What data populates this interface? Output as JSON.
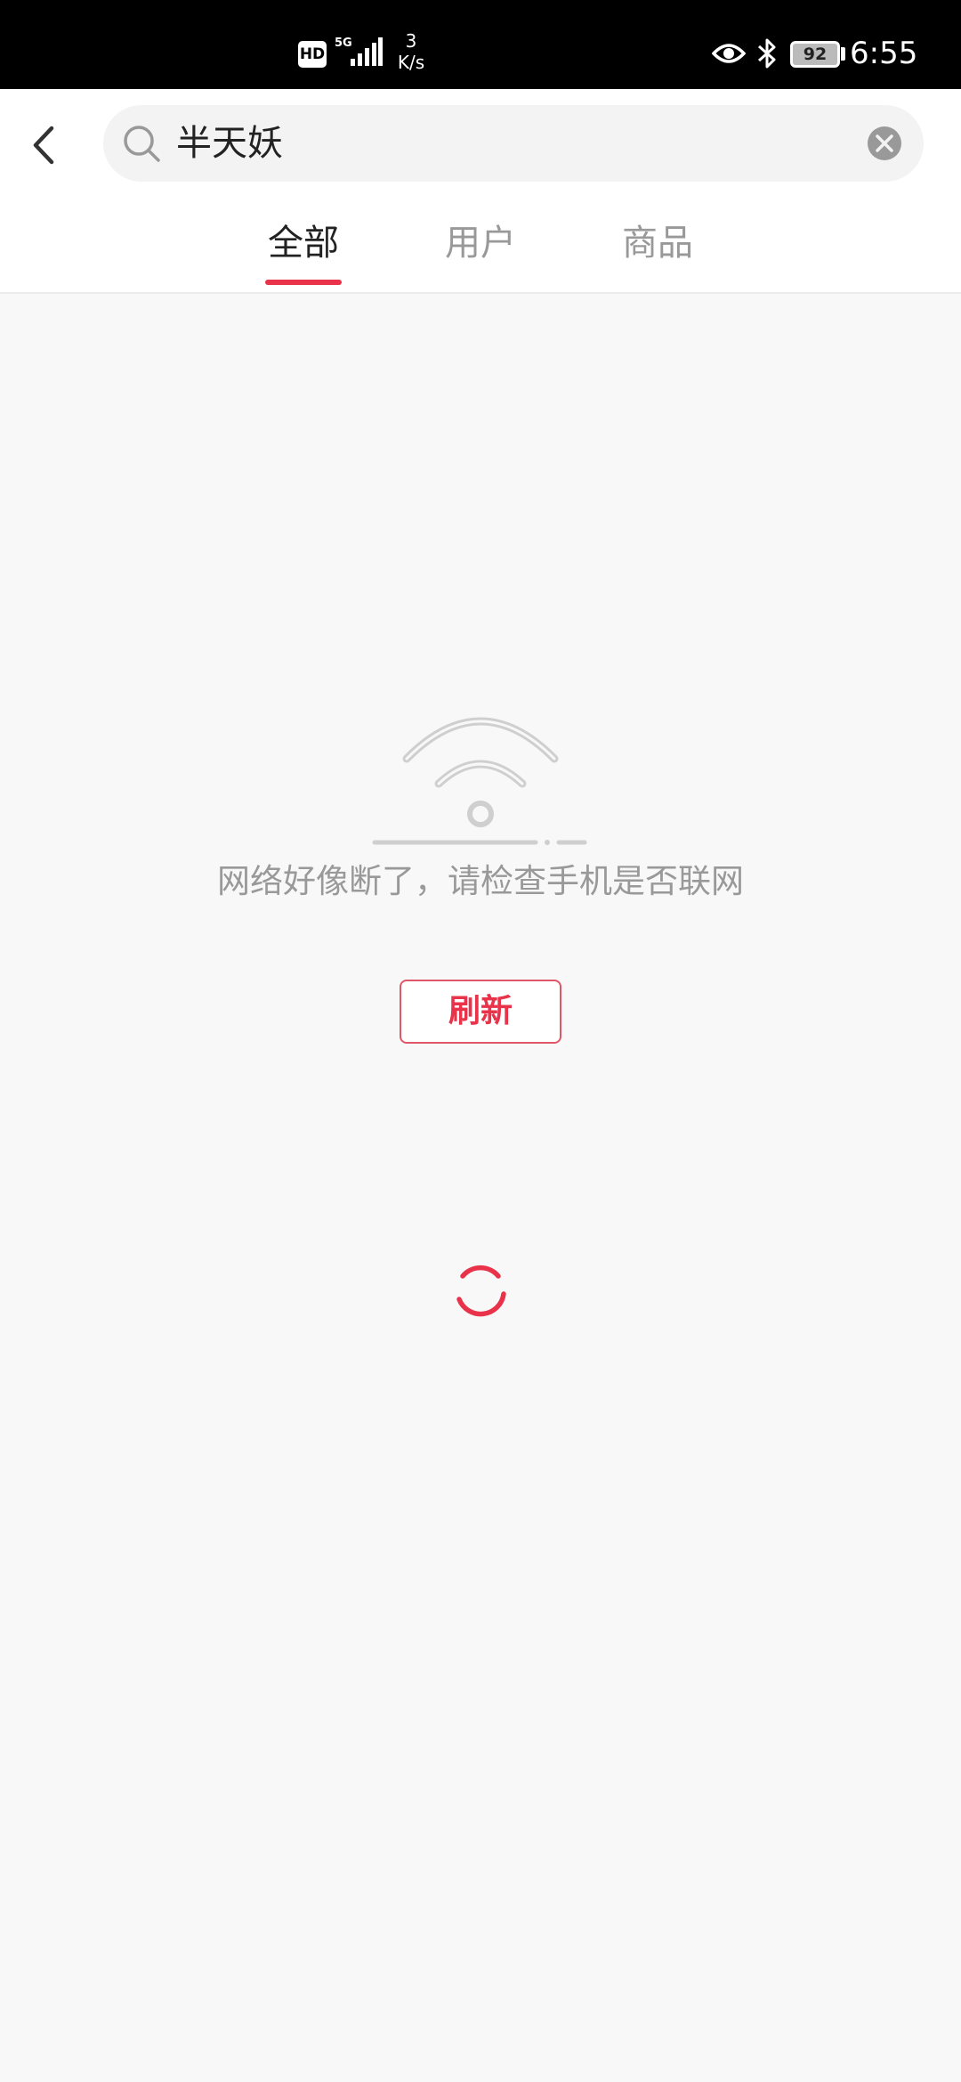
{
  "status_bar": {
    "hd": "HD",
    "network": "5G",
    "speed_value": "3",
    "speed_unit": "K/s",
    "battery": "92",
    "time": "6:55"
  },
  "search": {
    "query": "半天妖"
  },
  "tabs": [
    {
      "label": "全部",
      "active": true
    },
    {
      "label": "用户",
      "active": false
    },
    {
      "label": "商品",
      "active": false
    }
  ],
  "empty_state": {
    "message": "网络好像断了，请检查手机是否联网",
    "refresh_label": "刷新"
  },
  "colors": {
    "accent": "#e8334a",
    "background": "#f8f8f8",
    "muted_text": "#999999"
  }
}
